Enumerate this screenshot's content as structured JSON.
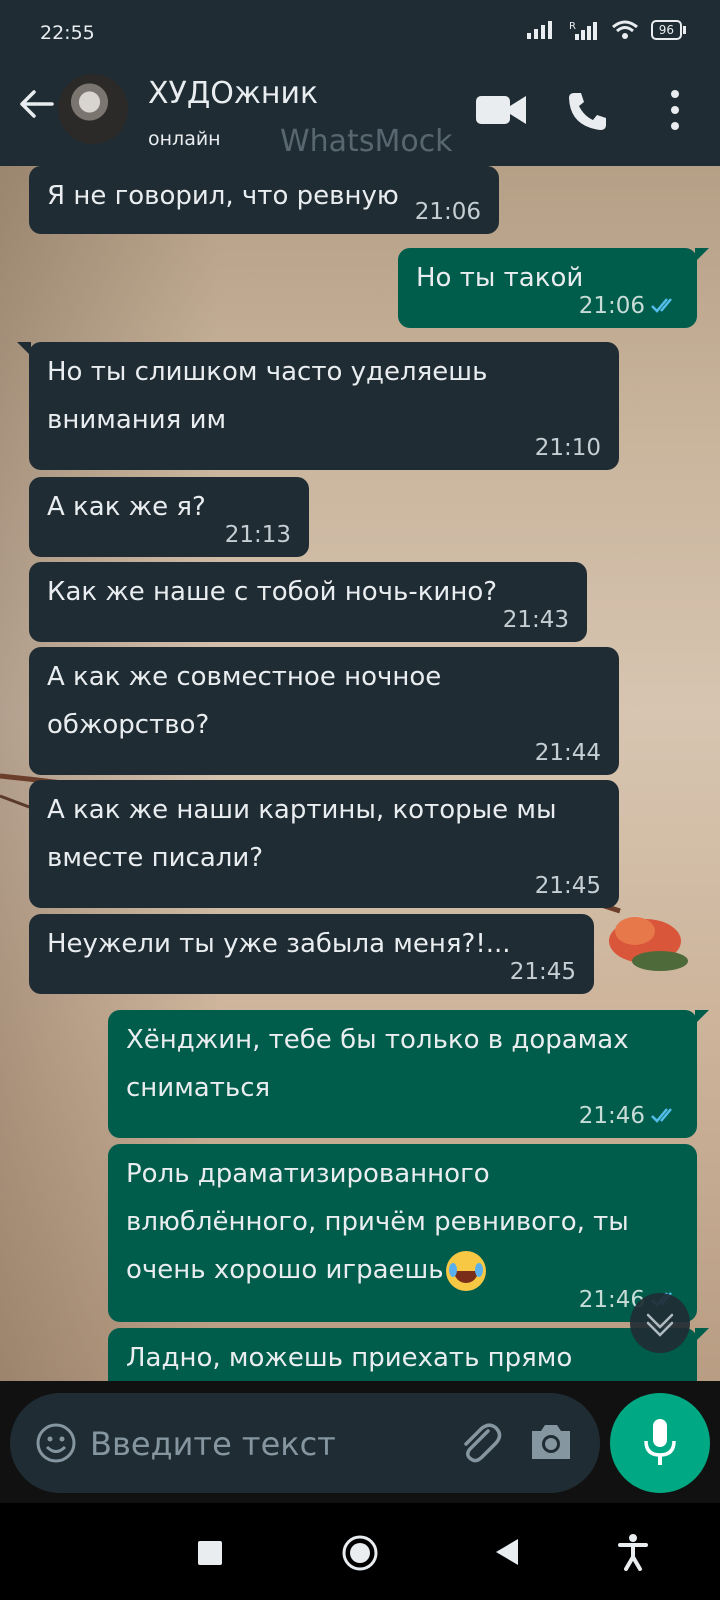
{
  "status_bar": {
    "time": "22:55",
    "battery": "96"
  },
  "header": {
    "contact_name": "ХУДОжник",
    "contact_status": "онлайн",
    "watermark": "WhatsMock"
  },
  "messages": [
    {
      "text": "Я не говорил, что ревную",
      "time": "21:06",
      "direction": "in"
    },
    {
      "text": "Но ты такой",
      "time": "21:06",
      "direction": "out",
      "read": true
    },
    {
      "text": "Но ты слишком часто уделяешь внимания им",
      "time": "21:10",
      "direction": "in"
    },
    {
      "text": "А как же я?",
      "time": "21:13",
      "direction": "in"
    },
    {
      "text": "Как же наше с тобой ночь-кино?",
      "time": "21:43",
      "direction": "in"
    },
    {
      "text": "А как же совместное ночное обжорство?",
      "time": "21:44",
      "direction": "in"
    },
    {
      "text": "А как же наши картины, которые мы вместе писали?",
      "time": "21:45",
      "direction": "in"
    },
    {
      "text": "Неужели ты уже забыла меня?!...",
      "time": "21:45",
      "direction": "in"
    },
    {
      "text": "Хёнджин, тебе бы только в дорамах сниматься",
      "time": "21:46",
      "direction": "out",
      "read": true
    },
    {
      "text": "Роль драматизированного влюблённого, причём ревнивого, ты очень хорошо играешь",
      "emoji": "face-with-tears-of-joy",
      "time": "21:46",
      "direction": "out",
      "read": true
    },
    {
      "text": "Ладно, можешь приехать прямо сейчас?",
      "time": "",
      "direction": "out"
    }
  ],
  "composer": {
    "placeholder": "Введите текст"
  },
  "colors": {
    "bar": "#1f2c34",
    "incoming": "#1f2c34",
    "outgoing": "#005c4b",
    "accent": "#00a884",
    "read_tick": "#53bdeb"
  },
  "icons": [
    "back-arrow-icon",
    "video-call-icon",
    "phone-icon",
    "more-vert-icon",
    "emoji-icon",
    "paperclip-icon",
    "camera-icon",
    "mic-icon",
    "chevron-down-icon"
  ]
}
